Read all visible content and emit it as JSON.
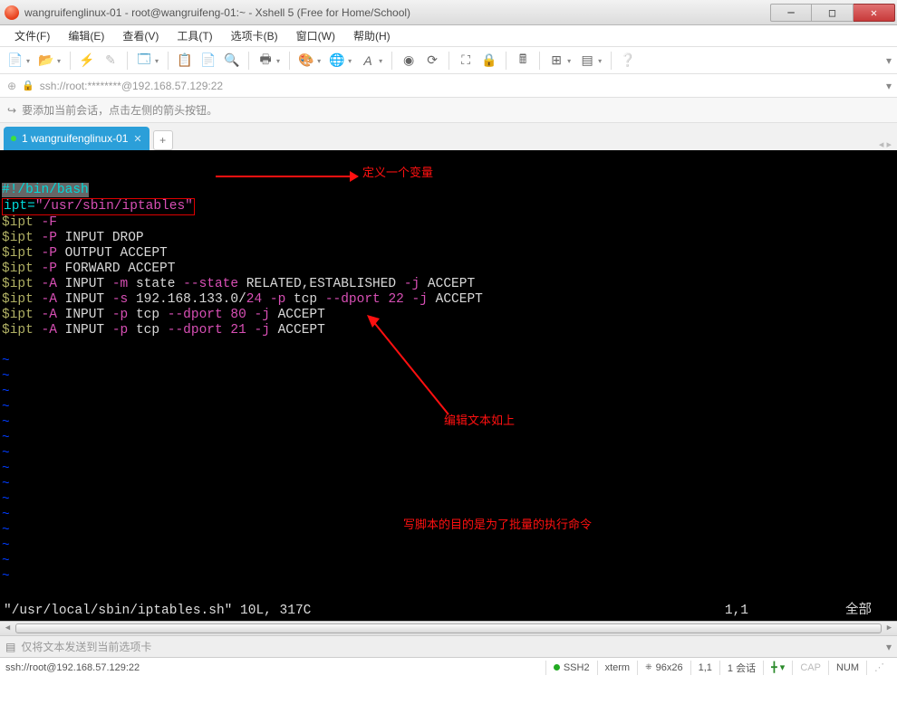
{
  "window": {
    "title": "wangruifenglinux-01 - root@wangruifeng-01:~ - Xshell 5 (Free for Home/School)"
  },
  "menu": {
    "file": "文件(F)",
    "edit": "编辑(E)",
    "view": "查看(V)",
    "tools": "工具(T)",
    "tab": "选项卡(B)",
    "window": "窗口(W)",
    "help": "帮助(H)"
  },
  "address": "ssh://root:********@192.168.57.129:22",
  "info_hint": "要添加当前会话，点击左侧的箭头按钮。",
  "tab_label": "1 wangruifenglinux-01",
  "terminal": {
    "shebang": "#!/bin/bash",
    "l2a": "ipt=",
    "l2b": "\"/usr/sbin/iptables\"",
    "l3": "$ipt",
    "l3f": " -F",
    "l4f": " -P",
    "l4t": " INPUT DROP",
    "l5t": " OUTPUT ACCEPT",
    "l6t": " FORWARD ACCEPT",
    "l7a": " -A",
    "l7b": " INPUT ",
    "l7m": "-m",
    "l7s": " state ",
    "l7ss": "--state",
    "l7t": " RELATED,ESTABLISHED ",
    "l7j": "-j",
    "l7ac": " ACCEPT",
    "l8s": "-s",
    "l8ip": " 192.168.133.0/",
    "l8m": "24 ",
    "l8p": "-p",
    "l8tcp": " tcp ",
    "l8dp": "--dport ",
    "l8n22": "22 ",
    "l9n80": "80 ",
    "l10n21": "21 ",
    "annot1": "定义一个变量",
    "annot2": "编辑文本如上",
    "annot3": "写脚本的目的是为了批量的执行命令",
    "vim_file": "\"/usr/local/sbin/iptables.sh\" 10L, 317C",
    "vim_pos": "1,1",
    "vim_all": "全部"
  },
  "sendbar_hint": "仅将文本发送到当前选项卡",
  "status": {
    "conn": "ssh://root@192.168.57.129:22",
    "ssh2": "SSH2",
    "term": "xterm",
    "size": "96x26",
    "rc": "1,1",
    "sess": "1 会话",
    "caps": "CAP",
    "num": "NUM"
  }
}
